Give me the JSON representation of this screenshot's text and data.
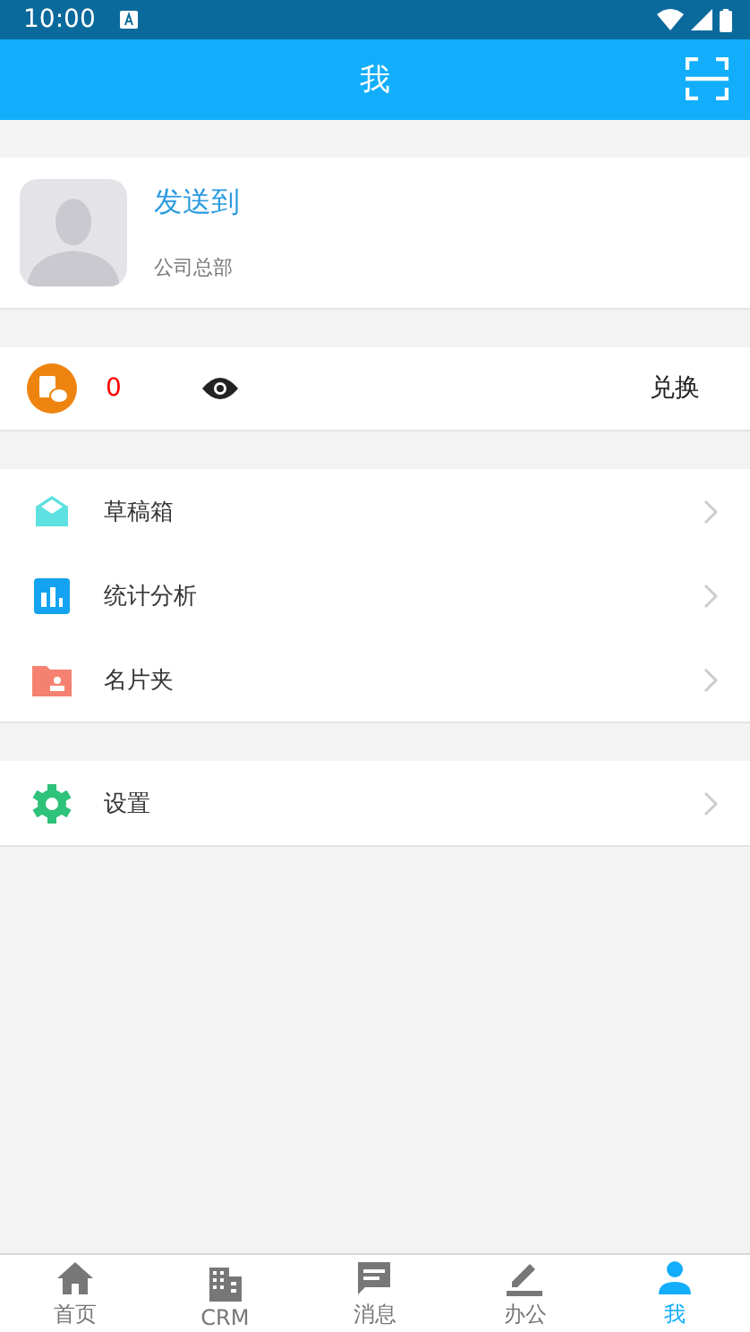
{
  "status_bar": {
    "time": "10:00"
  },
  "header": {
    "title": "我"
  },
  "profile": {
    "name": "发送到",
    "department": "公司总部"
  },
  "points": {
    "value": "0",
    "action": "兑换"
  },
  "menu_groups": [
    [
      {
        "kind": "drafts",
        "label": "草稿箱"
      },
      {
        "kind": "stats",
        "label": "统计分析"
      },
      {
        "kind": "cards",
        "label": "名片夹"
      }
    ],
    [
      {
        "kind": "settings",
        "label": "设置"
      }
    ]
  ],
  "tabs": [
    {
      "kind": "home",
      "label": "首页",
      "selected": false
    },
    {
      "kind": "crm",
      "label": "CRM",
      "selected": false
    },
    {
      "kind": "messages",
      "label": "消息",
      "selected": false
    },
    {
      "kind": "office",
      "label": "办公",
      "selected": false
    },
    {
      "kind": "me",
      "label": "我",
      "selected": true
    }
  ]
}
